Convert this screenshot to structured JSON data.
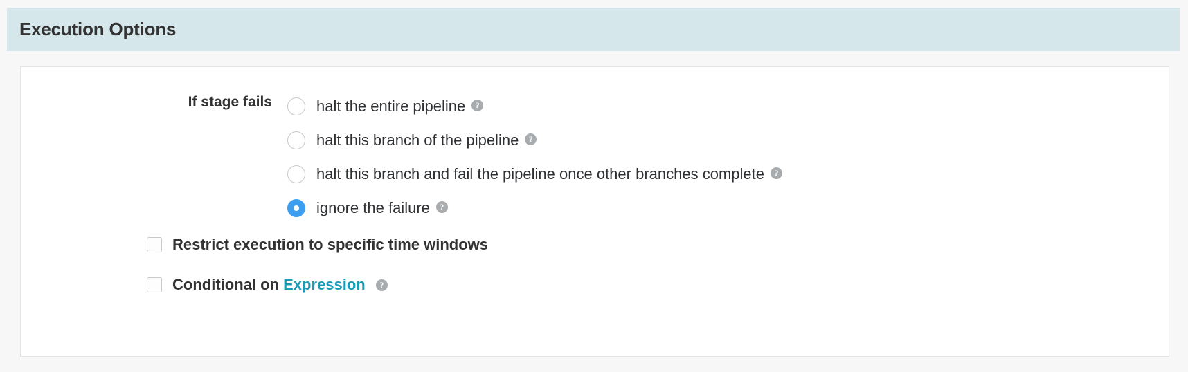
{
  "header": {
    "title": "Execution Options",
    "background_color": "#d5e7ea"
  },
  "form": {
    "stage_fails": {
      "label": "If stage fails",
      "selected_index": 3,
      "options": [
        {
          "label": "halt the entire pipeline",
          "help": "?",
          "selected": false
        },
        {
          "label": "halt this branch of the pipeline",
          "help": "?",
          "selected": false
        },
        {
          "label": "halt this branch and fail the pipeline once other branches complete",
          "help": "?",
          "selected": false
        },
        {
          "label": "ignore the failure",
          "help": "?",
          "selected": true
        }
      ]
    },
    "checkboxes": [
      {
        "label": "Restrict execution to specific time windows",
        "checked": false,
        "has_help": false,
        "link_text": "",
        "help": ""
      },
      {
        "label_prefix": "Conditional on",
        "link_text": "Expression",
        "checked": false,
        "has_help": true,
        "help": "?"
      }
    ]
  },
  "colors": {
    "header_bg": "#d5e7ea",
    "radio_selected": "#3d9ef0",
    "link": "#1a9cb7",
    "help_icon": "#a9acae",
    "page_bg": "#f7f7f7"
  }
}
